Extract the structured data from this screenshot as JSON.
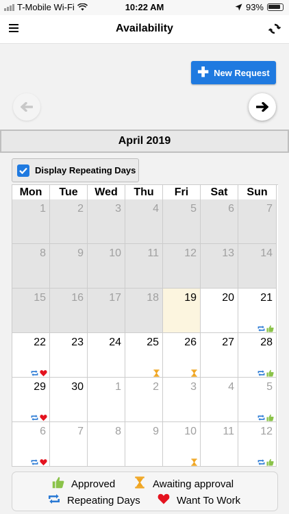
{
  "status_bar": {
    "carrier": "T-Mobile Wi-Fi",
    "time": "10:22 AM",
    "battery": "93%"
  },
  "nav": {
    "title": "Availability"
  },
  "new_request_label": "New Request",
  "calendar": {
    "month_label": "April 2019",
    "repeat_toggle_label": "Display Repeating Days",
    "repeat_toggle_checked": true,
    "days_of_week": [
      "Mon",
      "Tue",
      "Wed",
      "Thu",
      "Fri",
      "Sat",
      "Sun"
    ],
    "weeks": [
      [
        {
          "day": "1",
          "state": "past"
        },
        {
          "day": "2",
          "state": "past"
        },
        {
          "day": "3",
          "state": "past"
        },
        {
          "day": "4",
          "state": "past"
        },
        {
          "day": "5",
          "state": "past"
        },
        {
          "day": "6",
          "state": "past"
        },
        {
          "day": "7",
          "state": "past"
        }
      ],
      [
        {
          "day": "8",
          "state": "past"
        },
        {
          "day": "9",
          "state": "past"
        },
        {
          "day": "10",
          "state": "past"
        },
        {
          "day": "11",
          "state": "past"
        },
        {
          "day": "12",
          "state": "past"
        },
        {
          "day": "13",
          "state": "past"
        },
        {
          "day": "14",
          "state": "past"
        }
      ],
      [
        {
          "day": "15",
          "state": "past"
        },
        {
          "day": "16",
          "state": "past"
        },
        {
          "day": "17",
          "state": "past"
        },
        {
          "day": "18",
          "state": "past"
        },
        {
          "day": "19",
          "state": "today"
        },
        {
          "day": "20",
          "state": "current"
        },
        {
          "day": "21",
          "state": "current",
          "icons": [
            "repeating",
            "approved"
          ]
        }
      ],
      [
        {
          "day": "22",
          "state": "current",
          "icons": [
            "repeating",
            "want"
          ]
        },
        {
          "day": "23",
          "state": "current"
        },
        {
          "day": "24",
          "state": "current"
        },
        {
          "day": "25",
          "state": "current",
          "icons": [
            "awaiting"
          ]
        },
        {
          "day": "26",
          "state": "current",
          "icons": [
            "awaiting"
          ]
        },
        {
          "day": "27",
          "state": "current"
        },
        {
          "day": "28",
          "state": "current",
          "icons": [
            "repeating",
            "approved"
          ]
        }
      ],
      [
        {
          "day": "29",
          "state": "current",
          "icons": [
            "repeating",
            "want"
          ]
        },
        {
          "day": "30",
          "state": "current"
        },
        {
          "day": "1",
          "state": "other"
        },
        {
          "day": "2",
          "state": "other"
        },
        {
          "day": "3",
          "state": "other"
        },
        {
          "day": "4",
          "state": "other"
        },
        {
          "day": "5",
          "state": "other",
          "icons": [
            "repeating",
            "approved"
          ]
        }
      ],
      [
        {
          "day": "6",
          "state": "other",
          "icons": [
            "repeating",
            "want"
          ]
        },
        {
          "day": "7",
          "state": "other"
        },
        {
          "day": "8",
          "state": "other"
        },
        {
          "day": "9",
          "state": "other"
        },
        {
          "day": "10",
          "state": "other",
          "icons": [
            "awaiting"
          ]
        },
        {
          "day": "11",
          "state": "other"
        },
        {
          "day": "12",
          "state": "other",
          "icons": [
            "repeating",
            "approved"
          ]
        }
      ]
    ]
  },
  "legend": {
    "approved": "Approved",
    "awaiting": "Awaiting approval",
    "repeating": "Repeating Days",
    "want": "Want To Work"
  },
  "colors": {
    "accent": "#1f7ae0",
    "approved": "#8bc34a",
    "awaiting": "#f0a520",
    "repeating": "#2979d4",
    "want": "#e4131f",
    "today": "#fcf5df"
  }
}
